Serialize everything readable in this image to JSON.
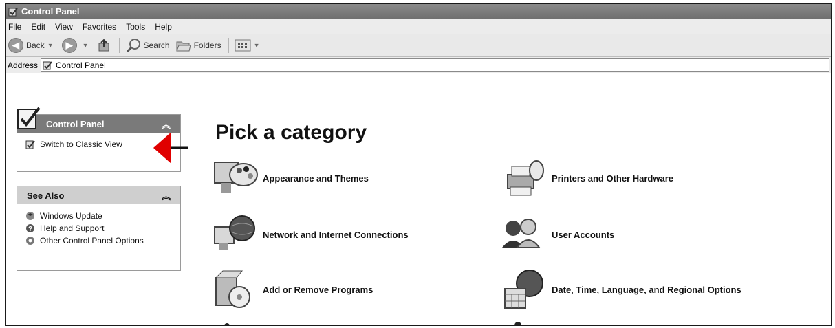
{
  "window": {
    "title": "Control Panel"
  },
  "menu": [
    "File",
    "Edit",
    "View",
    "Favorites",
    "Tools",
    "Help"
  ],
  "toolbar": {
    "back_label": "Back",
    "search_label": "Search",
    "folders_label": "Folders"
  },
  "address": {
    "label": "Address",
    "value": "Control Panel"
  },
  "sidebar": {
    "control_panel_title": "Control Panel",
    "switch_label": "Switch to Classic View",
    "see_also_title": "See Also",
    "see_also_items": [
      "Windows Update",
      "Help and Support",
      "Other Control Panel Options"
    ]
  },
  "main": {
    "heading": "Pick a category",
    "categories": [
      "Appearance and Themes",
      "Printers and Other Hardware",
      "Network and Internet Connections",
      "User Accounts",
      "Add or Remove Programs",
      "Date, Time, Language, and Regional Options"
    ]
  },
  "colors": {
    "annotation_arrow": "#e00000",
    "title_bar": "#7a7a7a"
  }
}
